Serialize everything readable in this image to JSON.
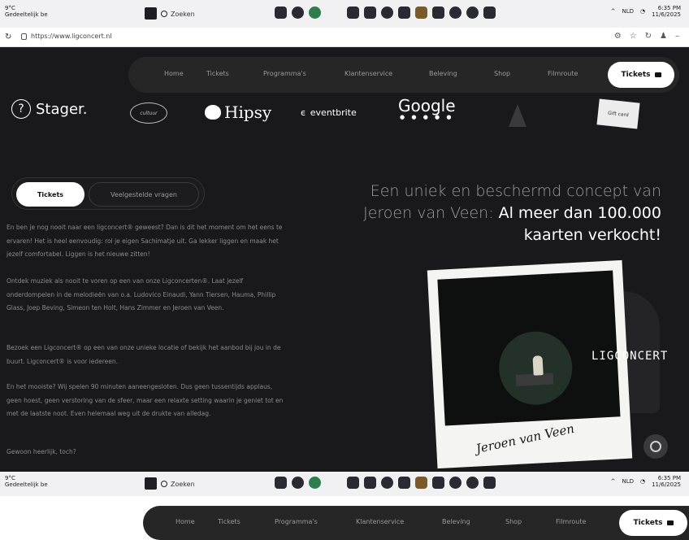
{
  "taskbar_top": {
    "weather_temp": "9°C",
    "weather_desc": "Gedeeltelijk be",
    "search_label": "Zoeken",
    "tray_text": "NLD",
    "time": "6:35 PM",
    "date": "11/6/2025"
  },
  "addressbar": {
    "url": "https://www.ligconcert.nl"
  },
  "nav": {
    "items": [
      "Home",
      "Tickets",
      "Programma's",
      "Klantenservice",
      "Beleving",
      "Shop",
      "Filmroute"
    ],
    "cta": "Tickets"
  },
  "logos": {
    "stager": "Stager.",
    "oval": "cultuur",
    "hipsy": "Hipsy",
    "eventbrite": "eventbrite",
    "google": "Google",
    "google_dots": "● ● ● ● ●",
    "sticker": "Gift card"
  },
  "tabs": {
    "active": "Tickets",
    "inactive": "Veelgestelde vragen"
  },
  "paragraphs": [
    "En ben je nog nooit naar een ligconcert® geweest? Dan is dit het moment om het eens te ervaren! Het is heel eenvoudig: rol je eigen Sachimatje uit. Ga lekker liggen en maak het jezelf comfortabel. Liggen is het nieuwe zitten!",
    "Ontdek muziek als nooit te voren op een van onze Ligconcerten®. Laat jezelf onderdompelen in de melodieën van o.a. Ludovico Einaudi, Yann Tiersen, Hauma, Phillip Glass, Joep Beving, Simeon ten Holt, Hans Zimmer en Jeroen van Veen.",
    "Bezoek een Ligconcert® op een van onze unieke locatie of bekijk het aanbod bij jou in de buurt. Ligconcert® is voor iedereen.",
    "En het mooiste? Wij spelen 90 minuten aaneengesloten. Dus geen tussentijds applaus, geen hoest, geen verstoring van de sfeer, maar een relaxte setting waarin je geniet tot en met de laatste noot. Even helemaal weg uit de drukte van alledag.",
    "Gewoon heerlijk, toch?"
  ],
  "headline": {
    "part1": "Een uniek en beschermd concept van Jeroen van Veen:",
    "part2": "Al meer dan 100.000 kaarten verkocht!"
  },
  "polaroid": {
    "signature": "Jeroen van Veen",
    "brand_logo": "LIGCONCERT"
  },
  "taskbar_bottom": {
    "weather_temp": "9°C",
    "weather_desc": "Gedeeltelijk be",
    "search_label": "Zoeken",
    "tray_text": "NLD",
    "time": "6:35 PM",
    "date": "11/6/2025"
  },
  "bottom_nav": {
    "items": [
      "Home",
      "Tickets",
      "Programma's",
      "Klantenservice",
      "Beleving",
      "Shop",
      "Filmroute"
    ],
    "cta": "Tickets"
  }
}
